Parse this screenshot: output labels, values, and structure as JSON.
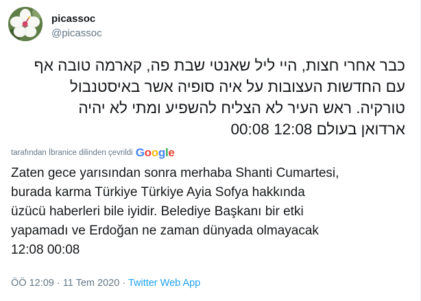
{
  "user": {
    "display_name": "picassoc",
    "handle": "@picassoc"
  },
  "tweet": {
    "original_lines": [
      "כבר אחרי חצות, היי ליל שאנטי שבת פה, קארמה טובה אף",
      "עם החדשות העצובות על איה סופיה אשר באיסטנבול",
      "טורקיה. ראש העיר לא הצליח להשפיע ומתי לא יהיה",
      "ארדואן בעולם 12:08 00:08"
    ],
    "translated_by_text": "tarafından İbranice dilinden çevrildi",
    "google_letters": [
      "G",
      "o",
      "o",
      "g",
      "l",
      "e"
    ],
    "translation_lines": [
      "Zaten gece yarısından sonra merhaba Shanti Cumartesi,",
      "burada karma Türkiye Türkiye Ayia Sofya hakkında",
      "üzücü haberleri bile iyidir. Belediye Başkanı bir etki",
      "yapamadı ve Erdoğan ne zaman dünyada olmayacak",
      "12:08 00:08"
    ],
    "time": "ÖÖ 12:09",
    "separator": "·",
    "date": "11 Tem 2020",
    "app": "Twitter Web App"
  },
  "colors": {
    "text": "#14171a",
    "secondary": "#657786",
    "link": "#1da1f2"
  }
}
